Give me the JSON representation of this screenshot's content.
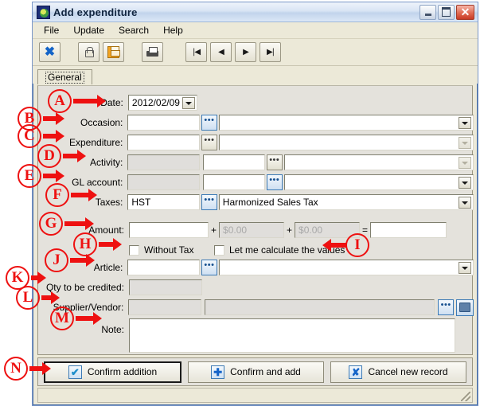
{
  "window": {
    "title": "Add expenditure",
    "icon": "app-icon",
    "controls": {
      "minimize": "minimize-button",
      "maximize": "maximize-button",
      "close": "close-button"
    }
  },
  "menu": {
    "items": [
      "File",
      "Update",
      "Search",
      "Help"
    ]
  },
  "toolbar": {
    "buttons": [
      {
        "name": "close-record-button",
        "icon": "x-icon"
      },
      {
        "name": "lock-button",
        "icon": "padlock-icon"
      },
      {
        "name": "save-button",
        "icon": "floppy-disk-icon"
      },
      {
        "name": "print-button",
        "icon": "printer-icon"
      },
      {
        "name": "first-record-button",
        "icon": "skip-first-icon",
        "glyph": "|◀"
      },
      {
        "name": "previous-record-button",
        "icon": "previous-icon",
        "glyph": "◀"
      },
      {
        "name": "next-record-button",
        "icon": "next-icon",
        "glyph": "▶"
      },
      {
        "name": "last-record-button",
        "icon": "skip-last-icon",
        "glyph": "▶|"
      }
    ]
  },
  "tabs": [
    {
      "label": "General",
      "active": true
    }
  ],
  "form": {
    "date": {
      "label": "Date:",
      "value": "2012/02/09"
    },
    "occasion": {
      "label": "Occasion:",
      "value": "",
      "description": ""
    },
    "expenditure": {
      "label": "Expenditure:",
      "value": "",
      "description": ""
    },
    "activity": {
      "label": "Activity:",
      "code": "",
      "value": "",
      "description": ""
    },
    "gl_account": {
      "label": "GL account:",
      "code": "",
      "value": "",
      "description": ""
    },
    "taxes": {
      "label": "Taxes:",
      "value": "HST",
      "description": "Harmonized Sales Tax"
    },
    "amount": {
      "label": "Amount:",
      "value": "",
      "plus1_label": "+",
      "tax1_placeholder": "$0.00",
      "tax1_value": "",
      "plus2_label": "+",
      "tax2_placeholder": "$0.00",
      "tax2_value": "",
      "equals_label": "=",
      "total_value": ""
    },
    "without_tax": {
      "label": "Without Tax",
      "checked": false
    },
    "let_me_calc": {
      "label": "Let me calculate the values",
      "checked": false
    },
    "article": {
      "label": "Article:",
      "value": "",
      "description": ""
    },
    "qty_credited": {
      "label": "Qty to be credited:",
      "value": ""
    },
    "supplier": {
      "label": "Supplier/Vendor:",
      "code": "",
      "value": ""
    },
    "note": {
      "label": "Note:",
      "value": ""
    }
  },
  "actions": {
    "confirm_addition": {
      "label": "Confirm addition",
      "icon": "checkmark-icon",
      "glyph": "✔",
      "default": true
    },
    "confirm_and_add": {
      "label": "Confirm and add",
      "icon": "plus-icon",
      "glyph": "✚"
    },
    "cancel_new_record": {
      "label": "Cancel new record",
      "icon": "x-icon",
      "glyph": "✘"
    }
  },
  "annotations": [
    {
      "letter": "A",
      "target": "date-field"
    },
    {
      "letter": "B",
      "target": "occasion-field"
    },
    {
      "letter": "C",
      "target": "expenditure-field"
    },
    {
      "letter": "D",
      "target": "activity-field"
    },
    {
      "letter": "E",
      "target": "gl-account-field"
    },
    {
      "letter": "F",
      "target": "taxes-field"
    },
    {
      "letter": "G",
      "target": "amount-field"
    },
    {
      "letter": "H",
      "target": "without-tax-checkbox"
    },
    {
      "letter": "I",
      "target": "let-me-calculate-checkbox"
    },
    {
      "letter": "J",
      "target": "article-field"
    },
    {
      "letter": "K",
      "target": "qty-to-be-credited-field"
    },
    {
      "letter": "L",
      "target": "supplier-vendor-field"
    },
    {
      "letter": "M",
      "target": "note-field"
    },
    {
      "letter": "N",
      "target": "confirm-addition-button"
    }
  ],
  "colors": {
    "annotation": "#ee1111",
    "accent": "#3c7ab5",
    "window_bg": "#e4e2dc",
    "save_icon": "#f5a623"
  }
}
